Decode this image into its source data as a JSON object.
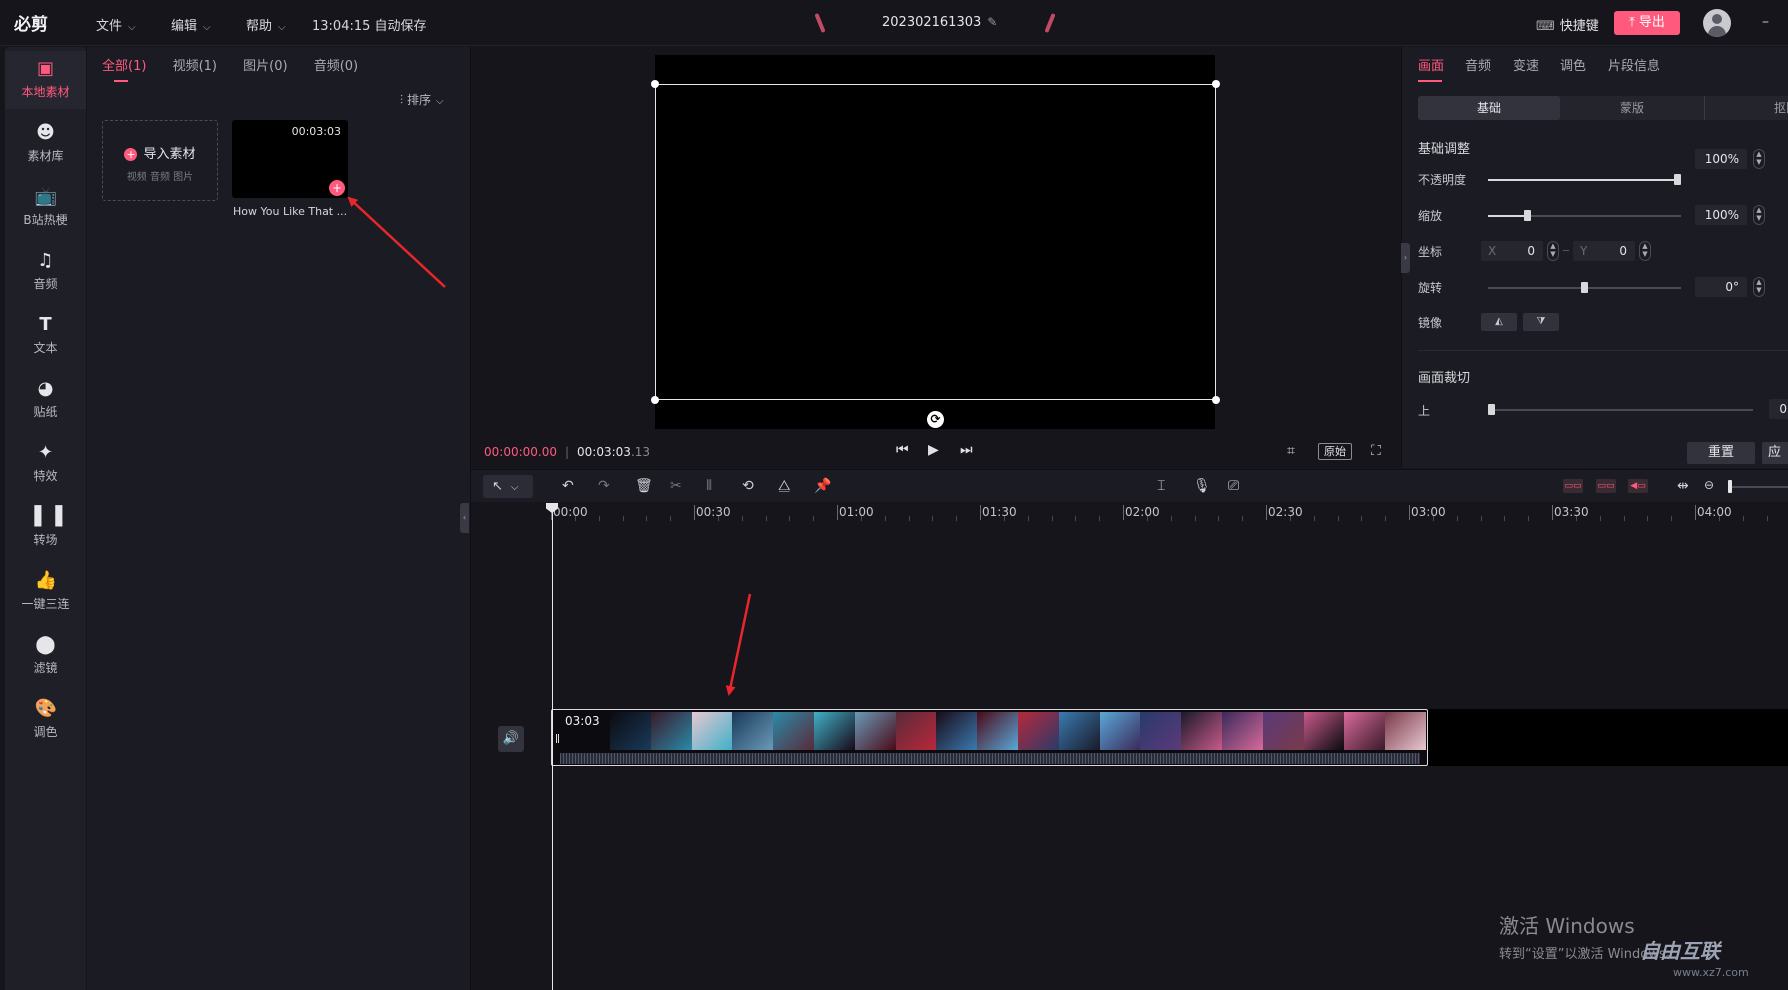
{
  "app": {
    "name": "必剪",
    "menus": [
      "文件",
      "编辑",
      "帮助"
    ],
    "autosave": "13:04:15 自动保存",
    "project_title": "202302161303",
    "shortcut_label": "快捷键",
    "export_label": "导出",
    "brand_color": "#ff5a7e"
  },
  "sidebar": {
    "items": [
      {
        "label": "本地素材",
        "icon": "local-media-icon",
        "active": true
      },
      {
        "label": "素材库",
        "icon": "material-library-icon"
      },
      {
        "label": "B站热梗",
        "icon": "bilibili-tv-icon"
      },
      {
        "label": "音频",
        "icon": "music-note-icon"
      },
      {
        "label": "文本",
        "icon": "text-t-icon"
      },
      {
        "label": "贴纸",
        "icon": "sticker-icon"
      },
      {
        "label": "特效",
        "icon": "effects-icon"
      },
      {
        "label": "转场",
        "icon": "transition-icon"
      },
      {
        "label": "一键三连",
        "icon": "thumbs-up-icon"
      },
      {
        "label": "滤镜",
        "icon": "filter-icon"
      },
      {
        "label": "调色",
        "icon": "palette-icon"
      }
    ]
  },
  "media": {
    "tabs": [
      "全部(1)",
      "视频(1)",
      "图片(0)",
      "音频(0)"
    ],
    "active_tab": 0,
    "sort_label": "排序",
    "import_label": "导入素材",
    "import_hint": "视频  音频  图片",
    "clip": {
      "duration": "00:03:03",
      "name": "How You Like That ..."
    }
  },
  "preview": {
    "time_current": "00:00:00.00",
    "time_total_main": "00:03:03",
    "time_total_frac": ".13",
    "ratio_label": "原始"
  },
  "properties": {
    "tabs": [
      "画面",
      "音频",
      "变速",
      "调色",
      "片段信息"
    ],
    "active_tab": 0,
    "subtabs": [
      "基础",
      "蒙版",
      "抠图"
    ],
    "active_subtab": 0,
    "section_basic": "基础调整",
    "opacity": {
      "label": "不透明度",
      "value": "100%",
      "level": 1.0
    },
    "scale": {
      "label": "缩放",
      "value": "100%",
      "level": 0.2
    },
    "position": {
      "label": "坐标",
      "x_axis": "X",
      "x": "0",
      "y_axis": "Y",
      "y": "0"
    },
    "rotation": {
      "label": "旋转",
      "value": "0°",
      "level": 0.5
    },
    "mirror": {
      "label": "镜像"
    },
    "section_crop": "画面裁切",
    "crop_top": {
      "label": "上",
      "value": "0",
      "level": 0.0
    },
    "reset_label": "重置",
    "apply_label": "应"
  },
  "timeline": {
    "ruler_labels": [
      "00:00",
      "00:30",
      "01:00",
      "01:30",
      "02:00",
      "02:30",
      "03:00",
      "03:30",
      "04:00"
    ],
    "clip_label": "03:03"
  },
  "watermark": {
    "line1": "激活 Windows",
    "line2": "转到“设置”以激活 Windows。",
    "site": "自由互联",
    "url": "www.xz7.com"
  }
}
